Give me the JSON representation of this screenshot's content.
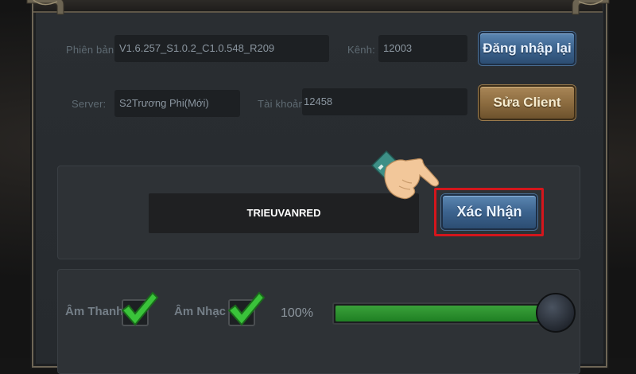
{
  "settings": {
    "version_label": "Phiên bản:",
    "version_value": "V1.6.257_S1.0.2_C1.0.548_R209",
    "channel_label": "Kênh:",
    "channel_value": "12003",
    "relogin_button": "Đăng nhập lại",
    "server_label": "Server:",
    "server_value": "S2Trương Phi(Mới)",
    "account_label": "Tài khoản:",
    "account_value": "12458",
    "edit_client_button": "Sửa Client"
  },
  "giftcode": {
    "value": "TRIEUVANRED",
    "confirm_button": "Xác Nhận"
  },
  "audio": {
    "sound_label": "Âm Thanh",
    "sound_checked": true,
    "music_label": "Âm Nhạc",
    "music_checked": true,
    "volume_text": "100%",
    "volume_fraction": 0.94
  },
  "colors": {
    "highlight": "#d4161c",
    "check": "#3ac33a",
    "slider_fill": "#2b9a2e"
  },
  "icons": {
    "pointer": "pointing-hand-icon",
    "check": "check-icon"
  }
}
